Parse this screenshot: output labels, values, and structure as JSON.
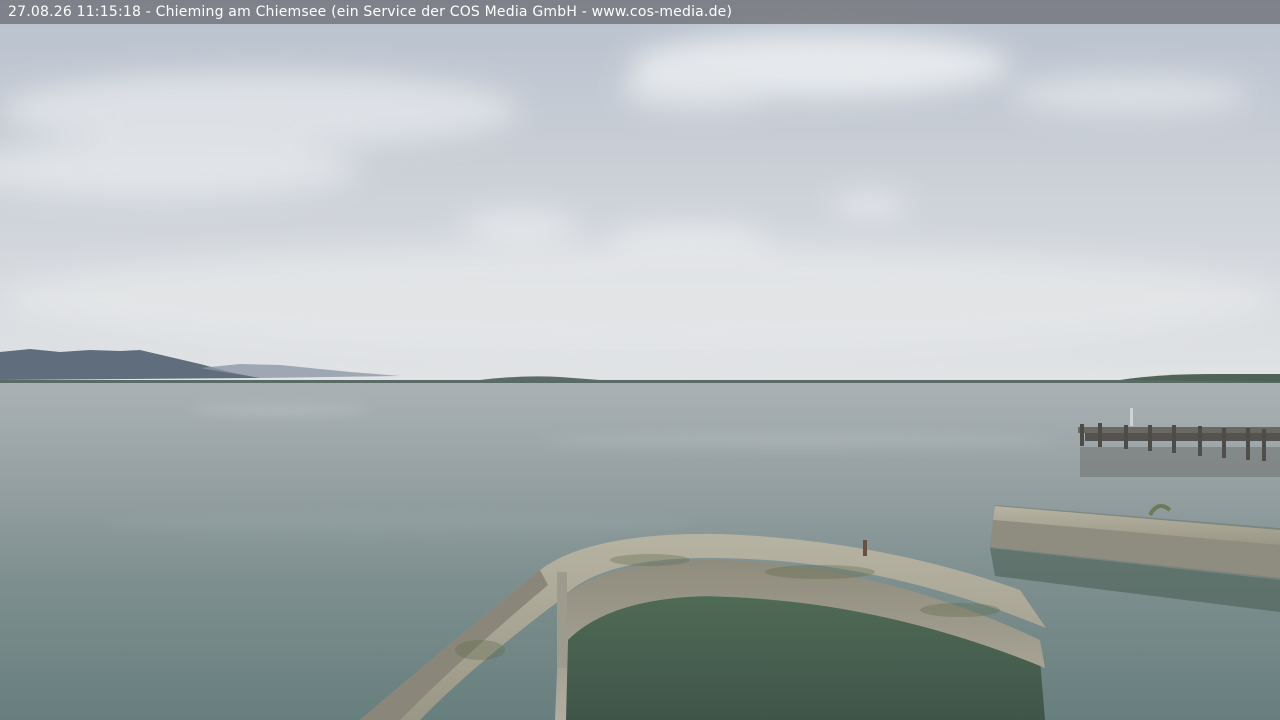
{
  "overlay": {
    "caption": "27.08.26 11:15:18 - Chieming am Chiemsee (ein Service der COS Media GmbH - www.cos-media.de)"
  },
  "scene": {
    "description_tags": [
      "sky-icon",
      "mountains-icon",
      "lake-icon",
      "pier-icon",
      "harbor-wall-icon"
    ],
    "colors": {
      "sky_top": "#b9c2cf",
      "sky_horizon": "#dfe2e5",
      "water_far": "#a4adb0",
      "water_near": "#6d8483",
      "stone": "#a29f92",
      "mountains": "#5f6e7d"
    }
  }
}
